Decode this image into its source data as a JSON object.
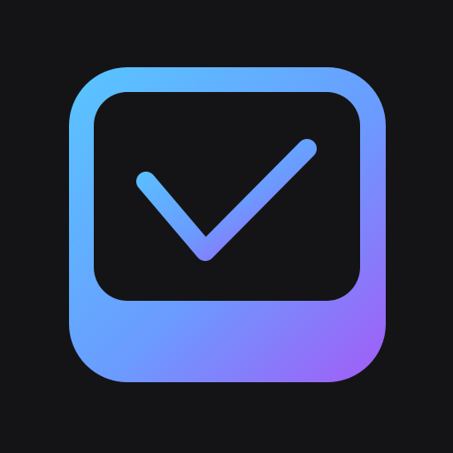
{
  "icon": {
    "name": "checkbox-check-icon",
    "background_color": "#141417",
    "inner_panel_color": "#141417",
    "gradient": {
      "start_color": "#58C6FF",
      "mid_color": "#6A9CFF",
      "end_color": "#A35CF6"
    }
  }
}
